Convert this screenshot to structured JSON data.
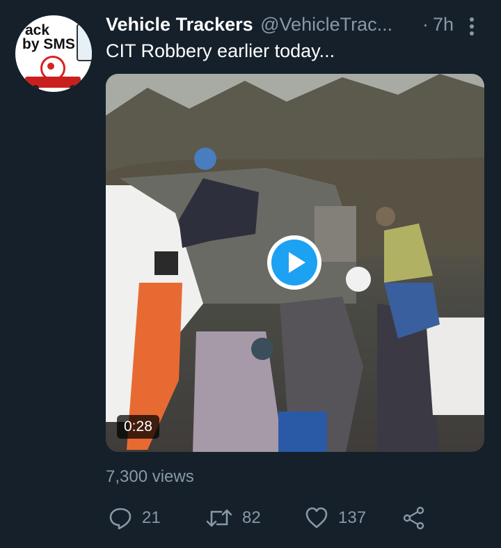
{
  "tweet": {
    "display_name": "Vehicle Trackers",
    "handle": "@VehicleTrac...",
    "separator": "·",
    "time": "7h",
    "text": "CIT Robbery earlier today...",
    "avatar": {
      "logo_line1": "ack",
      "logo_line2": "by SMS"
    },
    "media": {
      "duration": "0:28",
      "type": "video"
    },
    "views": "7,300 views",
    "actions": {
      "reply_count": "21",
      "retweet_count": "82",
      "like_count": "137"
    }
  },
  "icons": {
    "more": "more-vertical-icon",
    "reply": "reply-icon",
    "retweet": "retweet-icon",
    "like": "heart-icon",
    "share": "share-icon",
    "play": "play-icon"
  },
  "colors": {
    "background": "#15202b",
    "secondary_text": "#8899a6",
    "accent": "#1da1f2"
  }
}
